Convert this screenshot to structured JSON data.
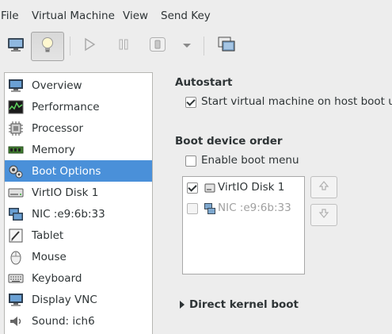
{
  "menubar": {
    "items": [
      "File",
      "Virtual Machine",
      "View",
      "Send Key"
    ]
  },
  "toolbar": {
    "buttons": [
      {
        "icon": "monitor-icon",
        "state": "normal"
      },
      {
        "icon": "lightbulb-icon",
        "state": "pressed"
      },
      {
        "icon": "play-icon",
        "state": "disabled"
      },
      {
        "icon": "pause-icon",
        "state": "disabled"
      },
      {
        "icon": "shutdown-icon",
        "state": "disabled"
      },
      {
        "icon": "chevron-down-icon",
        "state": "disabled"
      },
      {
        "icon": "fullscreen-icon",
        "state": "normal"
      }
    ]
  },
  "sidebar": {
    "selected": "Boot Options",
    "items": [
      {
        "label": "Overview",
        "icon": "overview-icon"
      },
      {
        "label": "Performance",
        "icon": "performance-icon"
      },
      {
        "label": "Processor",
        "icon": "processor-icon"
      },
      {
        "label": "Memory",
        "icon": "memory-icon"
      },
      {
        "label": "Boot Options",
        "icon": "boot-options-icon"
      },
      {
        "label": "VirtIO Disk 1",
        "icon": "disk-icon"
      },
      {
        "label": "NIC :e9:6b:33",
        "icon": "nic-icon"
      },
      {
        "label": "Tablet",
        "icon": "tablet-icon"
      },
      {
        "label": "Mouse",
        "icon": "mouse-icon"
      },
      {
        "label": "Keyboard",
        "icon": "keyboard-icon"
      },
      {
        "label": "Display VNC",
        "icon": "display-icon"
      },
      {
        "label": "Sound: ich6",
        "icon": "sound-icon"
      }
    ]
  },
  "autostart": {
    "title": "Autostart",
    "checkbox_label": "Start virtual machine on host boot up",
    "checked": true
  },
  "boot_order": {
    "title": "Boot device order",
    "enable_menu_label": "Enable boot menu",
    "enable_menu_checked": false,
    "devices": [
      {
        "label": "VirtIO Disk 1",
        "checked": true,
        "enabled": true
      },
      {
        "label": "NIC :e9:6b:33",
        "checked": false,
        "enabled": false
      }
    ]
  },
  "direct_kernel": {
    "label": "Direct kernel boot"
  },
  "colors": {
    "selection": "#4a90d9",
    "window_bg": "#ededed",
    "disabled_text": "#a0a0a0"
  }
}
